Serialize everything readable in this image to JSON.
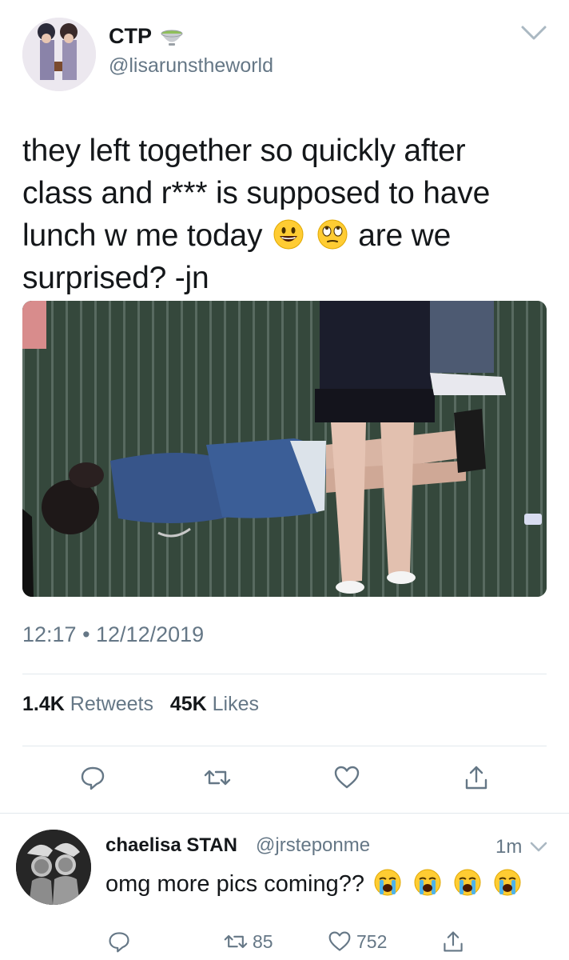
{
  "tweet": {
    "display_name": "CTP",
    "name_emoji": "tea-bowl-icon",
    "handle": "@lisarunstheworld",
    "text_lines": [
      "they left together so quickly after",
      "class and r*** is supposed to have",
      "lunch w me today",
      "are we",
      "surprised? -jn"
    ],
    "timestamp": "12:17 • 12/12/2019",
    "retweets_count": "1.4K",
    "retweets_label": "Retweets",
    "likes_count": "45K",
    "likes_label": "Likes"
  },
  "reply": {
    "display_name": "chaelisa STAN",
    "handle": "@jrsteponme",
    "time": "1m",
    "text": "omg more pics coming??",
    "retweet_count": "85",
    "like_count": "752"
  },
  "colors": {
    "text": "#14171a",
    "secondary": "#657786",
    "divider": "#e1e8ed",
    "caret": "#aab8c2"
  }
}
